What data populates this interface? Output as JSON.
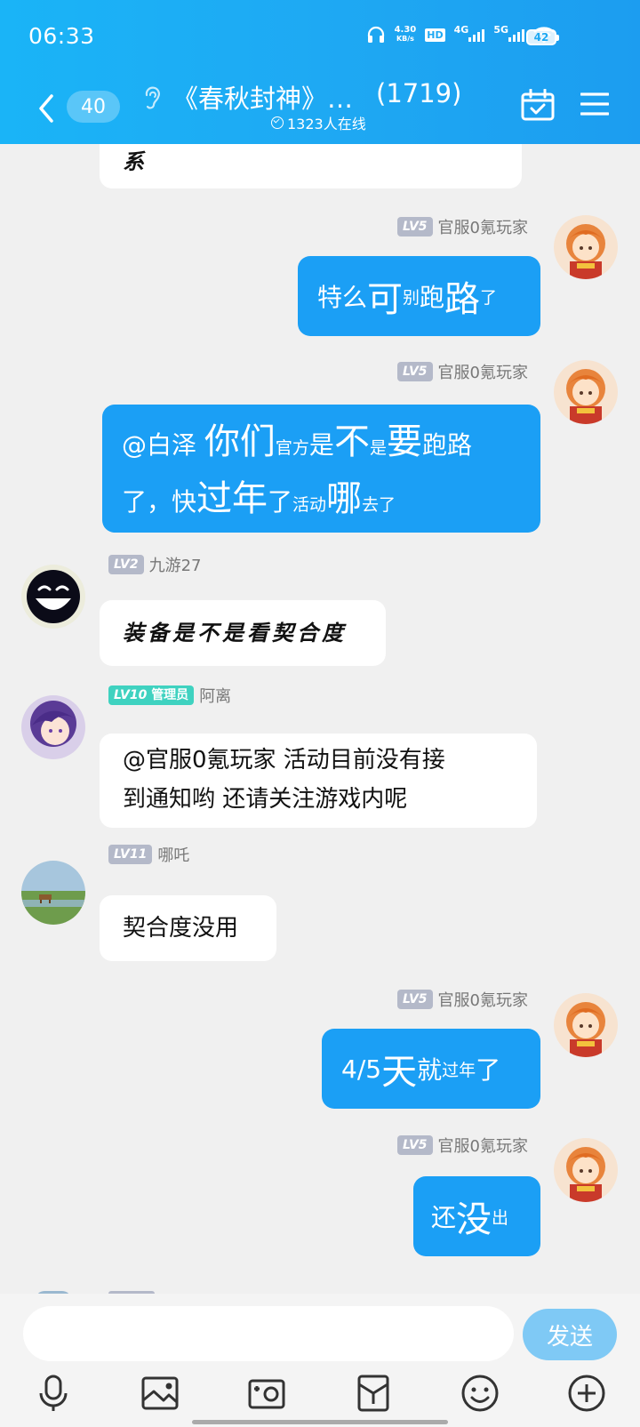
{
  "status_bar": {
    "time": "06:33",
    "net_speed_value": "4.30",
    "net_speed_unit": "KB/s",
    "hd_label": "HD",
    "sim1_label": "4G",
    "sim2_label": "5G",
    "battery": "42"
  },
  "header": {
    "unread_count": "40",
    "title": "《春秋封神》…",
    "member_count": "(1719)",
    "online_text": "1323人在线"
  },
  "messages": [
    {
      "id": "m0",
      "direction": "in",
      "text": "系"
    },
    {
      "id": "m1",
      "direction": "out",
      "level": "LV5",
      "sender": "官服0氪玩家",
      "parts": [
        [
          "m",
          "特么"
        ],
        [
          "b",
          "可"
        ],
        [
          "s",
          "别"
        ],
        [
          "m",
          "跑"
        ],
        [
          "b",
          "路"
        ],
        [
          "s",
          "了"
        ]
      ]
    },
    {
      "id": "m2",
      "direction": "out",
      "level": "LV5",
      "sender": "官服0氪玩家",
      "parts": [
        [
          "m",
          "@白泽 "
        ],
        [
          "b",
          "你们"
        ],
        [
          "s",
          "官方"
        ],
        [
          "m",
          "是"
        ],
        [
          "b",
          "不"
        ],
        [
          "s",
          "是"
        ],
        [
          "b",
          "要"
        ],
        [
          "m",
          "跑路"
        ],
        [
          "br",
          ""
        ],
        [
          "m",
          "了，快"
        ],
        [
          "b",
          "过年"
        ],
        [
          "m",
          "了"
        ],
        [
          "s",
          "活动"
        ],
        [
          "b",
          "哪"
        ],
        [
          "s",
          "去了"
        ]
      ]
    },
    {
      "id": "m3",
      "direction": "in",
      "level": "LV2",
      "sender": "九游27",
      "text": "装备是不是看契合度"
    },
    {
      "id": "m4",
      "direction": "in",
      "level": "LV10",
      "role": "管理员",
      "sender": "阿离",
      "lines": [
        "@官服0氪玩家 活动目前没有接",
        "到通知哟 还请关注游戏内呢"
      ]
    },
    {
      "id": "m5",
      "direction": "in",
      "level": "LV11",
      "sender": "哪吒",
      "text": "契合度没用"
    },
    {
      "id": "m6",
      "direction": "out",
      "level": "LV5",
      "sender": "官服0氪玩家",
      "parts": [
        [
          "m",
          "4/5"
        ],
        [
          "b",
          "天"
        ],
        [
          "m",
          "就"
        ],
        [
          "s",
          "过年"
        ],
        [
          "m",
          "了"
        ]
      ]
    },
    {
      "id": "m7",
      "direction": "out",
      "level": "LV5",
      "sender": "官服0氪玩家",
      "parts": [
        [
          "m",
          "还"
        ],
        [
          "b",
          "没"
        ],
        [
          "s",
          "出"
        ]
      ]
    }
  ],
  "input": {
    "placeholder": "",
    "send_label": "发送"
  },
  "toolbar": [
    "microphone-icon",
    "image-icon",
    "camera-icon",
    "red-packet-icon",
    "emoji-icon",
    "plus-icon"
  ],
  "colors": {
    "header": "#1ea9f3",
    "outgoing_bubble": "#1b9ff5",
    "incoming_bubble": "#ffffff",
    "send_button": "#7fc9f5",
    "admin_badge": "#3fd2c0",
    "level_badge": "#b4b9c9"
  }
}
